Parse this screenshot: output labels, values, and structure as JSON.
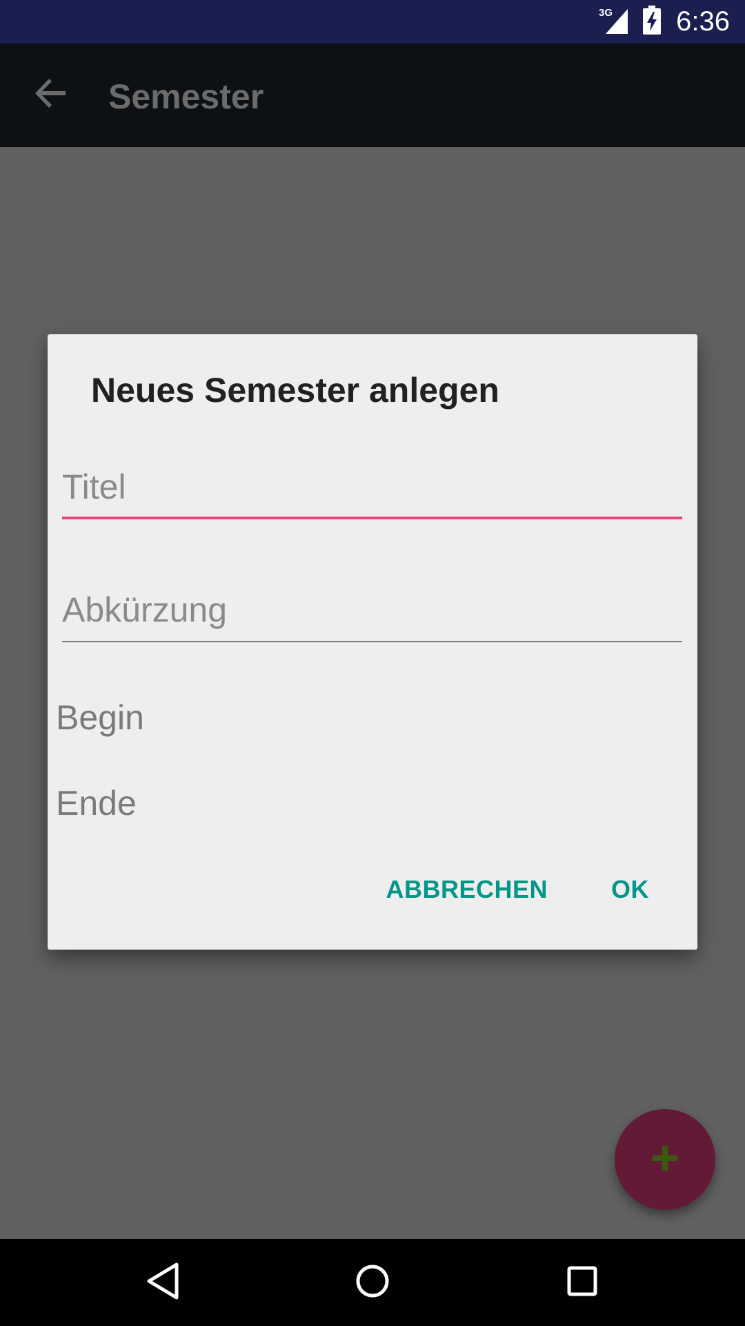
{
  "status_bar": {
    "network": "3G",
    "time": "6:36"
  },
  "app_bar": {
    "title": "Semester",
    "back_icon": "arrow-back-icon"
  },
  "dialog": {
    "title": "Neues Semester anlegen",
    "fields": {
      "title_placeholder": "Titel",
      "title_value": "",
      "abbreviation_placeholder": "Abkürzung",
      "abbreviation_value": ""
    },
    "begin_label": "Begin",
    "end_label": "Ende",
    "cancel_label": "ABBRECHEN",
    "ok_label": "OK"
  },
  "fab": {
    "icon": "plus-icon"
  },
  "colors": {
    "status_bar": "#1a1f4f",
    "app_bar": "#0e1114",
    "scrim_background": "#616161",
    "dialog_background": "#eeeeee",
    "accent_underline": "#ee4081",
    "button_text": "#009688",
    "fab_background": "#631a37",
    "fab_icon": "#3b5a0e"
  }
}
